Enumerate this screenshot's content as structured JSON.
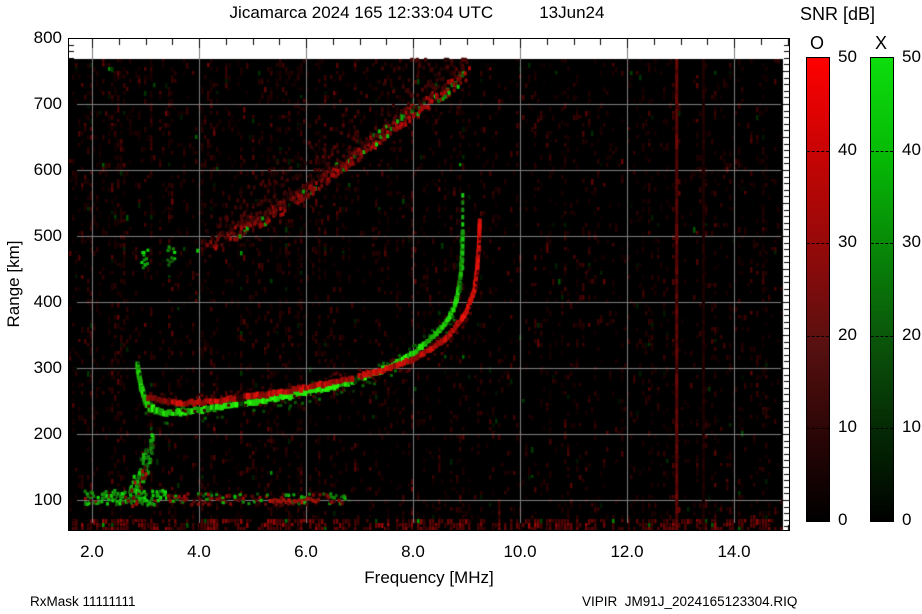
{
  "header": {
    "title": "Jicamarca 2024 165 12:33:04 UTC",
    "date": "13Jun24"
  },
  "colorbar_panel": {
    "title": "SNR [dB]",
    "bars": [
      {
        "label": "O",
        "top_color": "#ff0000",
        "ticks": [
          "50",
          "40",
          "30",
          "20",
          "10",
          "0"
        ]
      },
      {
        "label": "X",
        "top_color": "#0ddd0d",
        "ticks": [
          "50",
          "40",
          "30",
          "20",
          "10",
          "0"
        ]
      }
    ]
  },
  "axes": {
    "x_label": "Frequency [MHz]",
    "y_label": "Range [km]",
    "x_ticks": [
      {
        "v": 2,
        "label": "2.0"
      },
      {
        "v": 4,
        "label": "4.0"
      },
      {
        "v": 6,
        "label": "6.0"
      },
      {
        "v": 8,
        "label": "8.0"
      },
      {
        "v": 10,
        "label": "10.0"
      },
      {
        "v": 12,
        "label": "12.0"
      },
      {
        "v": 14,
        "label": "14.0"
      }
    ],
    "y_ticks": [
      {
        "v": 100,
        "label": "100"
      },
      {
        "v": 200,
        "label": "200"
      },
      {
        "v": 300,
        "label": "300"
      },
      {
        "v": 400,
        "label": "400"
      },
      {
        "v": 500,
        "label": "500"
      },
      {
        "v": 600,
        "label": "600"
      },
      {
        "v": 700,
        "label": "700"
      },
      {
        "v": 800,
        "label": "800"
      }
    ]
  },
  "footer": {
    "left": "RxMask 11111111",
    "right": "VIPIR  JM91J_2024165123304.RIQ"
  },
  "chart_data": {
    "type": "heatmap",
    "title": "Jicamarca 2024 165 12:33:04 UTC  13Jun24",
    "xlabel": "Frequency [MHz]",
    "ylabel": "Range [km]",
    "x_range_mhz": [
      1.57,
      15.06
    ],
    "y_range_km": [
      53,
      800
    ],
    "x_tick_values": [
      2,
      4,
      6,
      8,
      10,
      12,
      14
    ],
    "y_tick_values": [
      100,
      200,
      300,
      400,
      500,
      600,
      700,
      800
    ],
    "grid": true,
    "background": "#000000",
    "gridline_color": "#7e7e7e",
    "modes": {
      "O": {
        "color": "#ff0000",
        "snr_range_db": [
          0,
          50
        ]
      },
      "X": {
        "color": "#0ddd0d",
        "snr_range_db": [
          0,
          50
        ]
      }
    },
    "o_trace_km_vs_mhz": [
      [
        3.05,
        256
      ],
      [
        3.3,
        250
      ],
      [
        3.6,
        247
      ],
      [
        4.0,
        248
      ],
      [
        4.5,
        252
      ],
      [
        5.0,
        257
      ],
      [
        5.5,
        263
      ],
      [
        6.0,
        270
      ],
      [
        6.5,
        278
      ],
      [
        7.0,
        287
      ],
      [
        7.5,
        298
      ],
      [
        8.0,
        313
      ],
      [
        8.4,
        331
      ],
      [
        8.7,
        352
      ],
      [
        8.9,
        372
      ],
      [
        9.05,
        395
      ],
      [
        9.15,
        420
      ],
      [
        9.2,
        450
      ],
      [
        9.23,
        485
      ],
      [
        9.25,
        525
      ]
    ],
    "x_trace_km_vs_mhz": [
      [
        2.85,
        302
      ],
      [
        2.92,
        272
      ],
      [
        3.0,
        250
      ],
      [
        3.1,
        239
      ],
      [
        3.35,
        232
      ],
      [
        3.7,
        233
      ],
      [
        4.2,
        239
      ],
      [
        4.7,
        245
      ],
      [
        5.2,
        251
      ],
      [
        5.7,
        258
      ],
      [
        6.2,
        266
      ],
      [
        6.7,
        276
      ],
      [
        7.1,
        286
      ],
      [
        7.4,
        296
      ],
      [
        7.7,
        308
      ],
      [
        8.0,
        322
      ],
      [
        8.3,
        341
      ],
      [
        8.5,
        357
      ],
      [
        8.65,
        373
      ],
      [
        8.78,
        393
      ],
      [
        8.86,
        420
      ],
      [
        8.9,
        448
      ],
      [
        8.92,
        478
      ],
      [
        8.93,
        510
      ]
    ],
    "x_trace_dotted_asymptote": {
      "freq_mhz": 8.93,
      "km_from": 455,
      "km_to": 565
    },
    "second_reflection_km_vs_mhz": [
      [
        3.9,
        470
      ],
      [
        4.3,
        492
      ],
      [
        4.8,
        512
      ],
      [
        5.3,
        533
      ],
      [
        5.8,
        558
      ],
      [
        6.3,
        586
      ],
      [
        6.8,
        616
      ],
      [
        7.3,
        648
      ],
      [
        7.8,
        678
      ],
      [
        8.3,
        706
      ],
      [
        8.7,
        728
      ],
      [
        9.0,
        746
      ]
    ],
    "e_region": {
      "freq_from_mhz": 1.85,
      "freq_to_mhz": 6.7,
      "center_km": 103,
      "green_dominant_below_mhz": 3.35,
      "bright_red_segment_mhz": [
        5.25,
        6.2
      ]
    },
    "e_plume": {
      "from": [
        2.72,
        106
      ],
      "to": [
        3.12,
        194
      ]
    },
    "green_patches": [
      [
        2.95,
        468
      ],
      [
        3.45,
        472
      ]
    ],
    "interference_lines_mhz": [
      {
        "freq": 12.92,
        "strength": 0.9
      },
      {
        "freq": 13.42,
        "strength": 0.3
      }
    ],
    "bottom_noise_band_km": [
      53,
      68
    ],
    "data_region": {
      "freq_max_mhz": 14.92,
      "km_max": 768
    }
  }
}
